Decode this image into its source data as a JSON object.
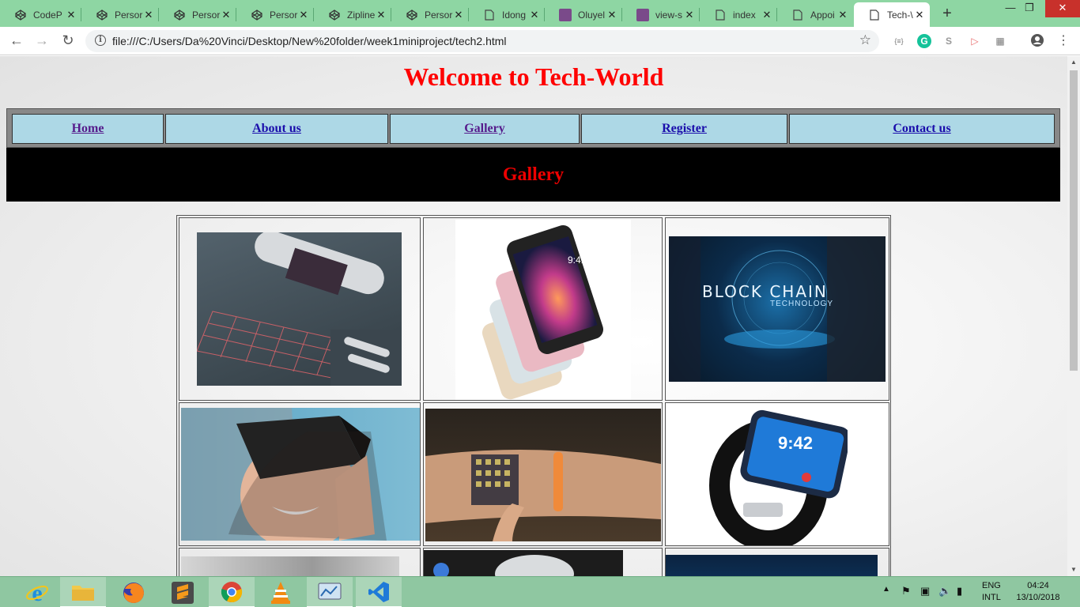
{
  "browser": {
    "tabs": [
      {
        "title": "CodeP",
        "icon": "codepen-icon"
      },
      {
        "title": "Persor",
        "icon": "codepen-icon"
      },
      {
        "title": "Persor",
        "icon": "codepen-icon"
      },
      {
        "title": "Persor",
        "icon": "codepen-icon"
      },
      {
        "title": "Zipline",
        "icon": "codepen-icon"
      },
      {
        "title": "Persor",
        "icon": "codepen-icon"
      },
      {
        "title": "Idong",
        "icon": "document-icon"
      },
      {
        "title": "Oluyel",
        "icon": "avatar-icon"
      },
      {
        "title": "view-s",
        "icon": "avatar-icon"
      },
      {
        "title": "index",
        "icon": "document-icon"
      },
      {
        "title": "Appoi",
        "icon": "document-icon"
      },
      {
        "title": "Tech-\\",
        "icon": "document-icon",
        "active": true
      }
    ],
    "url": "file:///C:/Users/Da%20Vinci/Desktop/New%20folder/week1miniproject/tech2.html"
  },
  "page": {
    "title": "Welcome to Tech-World",
    "nav": {
      "home": "Home",
      "about": "About us",
      "gallery": "Gallery",
      "register": "Register",
      "contact": "Contact us"
    },
    "heading": "Gallery",
    "gallery_images": [
      {
        "name": "laser-keyboard-image",
        "text": ""
      },
      {
        "name": "iphone-se-image",
        "text": "9:41"
      },
      {
        "name": "block-chain-image",
        "text": "BLOCK CHAIN",
        "subtext": "TECHNOLOGY"
      },
      {
        "name": "vr-headset-image",
        "text": ""
      },
      {
        "name": "wrist-projection-image",
        "text": ""
      },
      {
        "name": "smartwatch-image",
        "text": "9:42"
      }
    ]
  },
  "taskbar": {
    "apps": [
      "Internet Explorer",
      "File Explorer",
      "Firefox",
      "Sublime Text",
      "Chrome",
      "VLC",
      "Control Panel",
      "VS Code"
    ],
    "language": "ENG",
    "keyboard": "INTL",
    "time": "04:24",
    "date": "13/10/2018"
  },
  "colors": {
    "tabstrip": "#8ed6a3",
    "nav_cell": "#add8e6",
    "title_red": "#ff0000",
    "taskbar": "#8fc7a1"
  }
}
